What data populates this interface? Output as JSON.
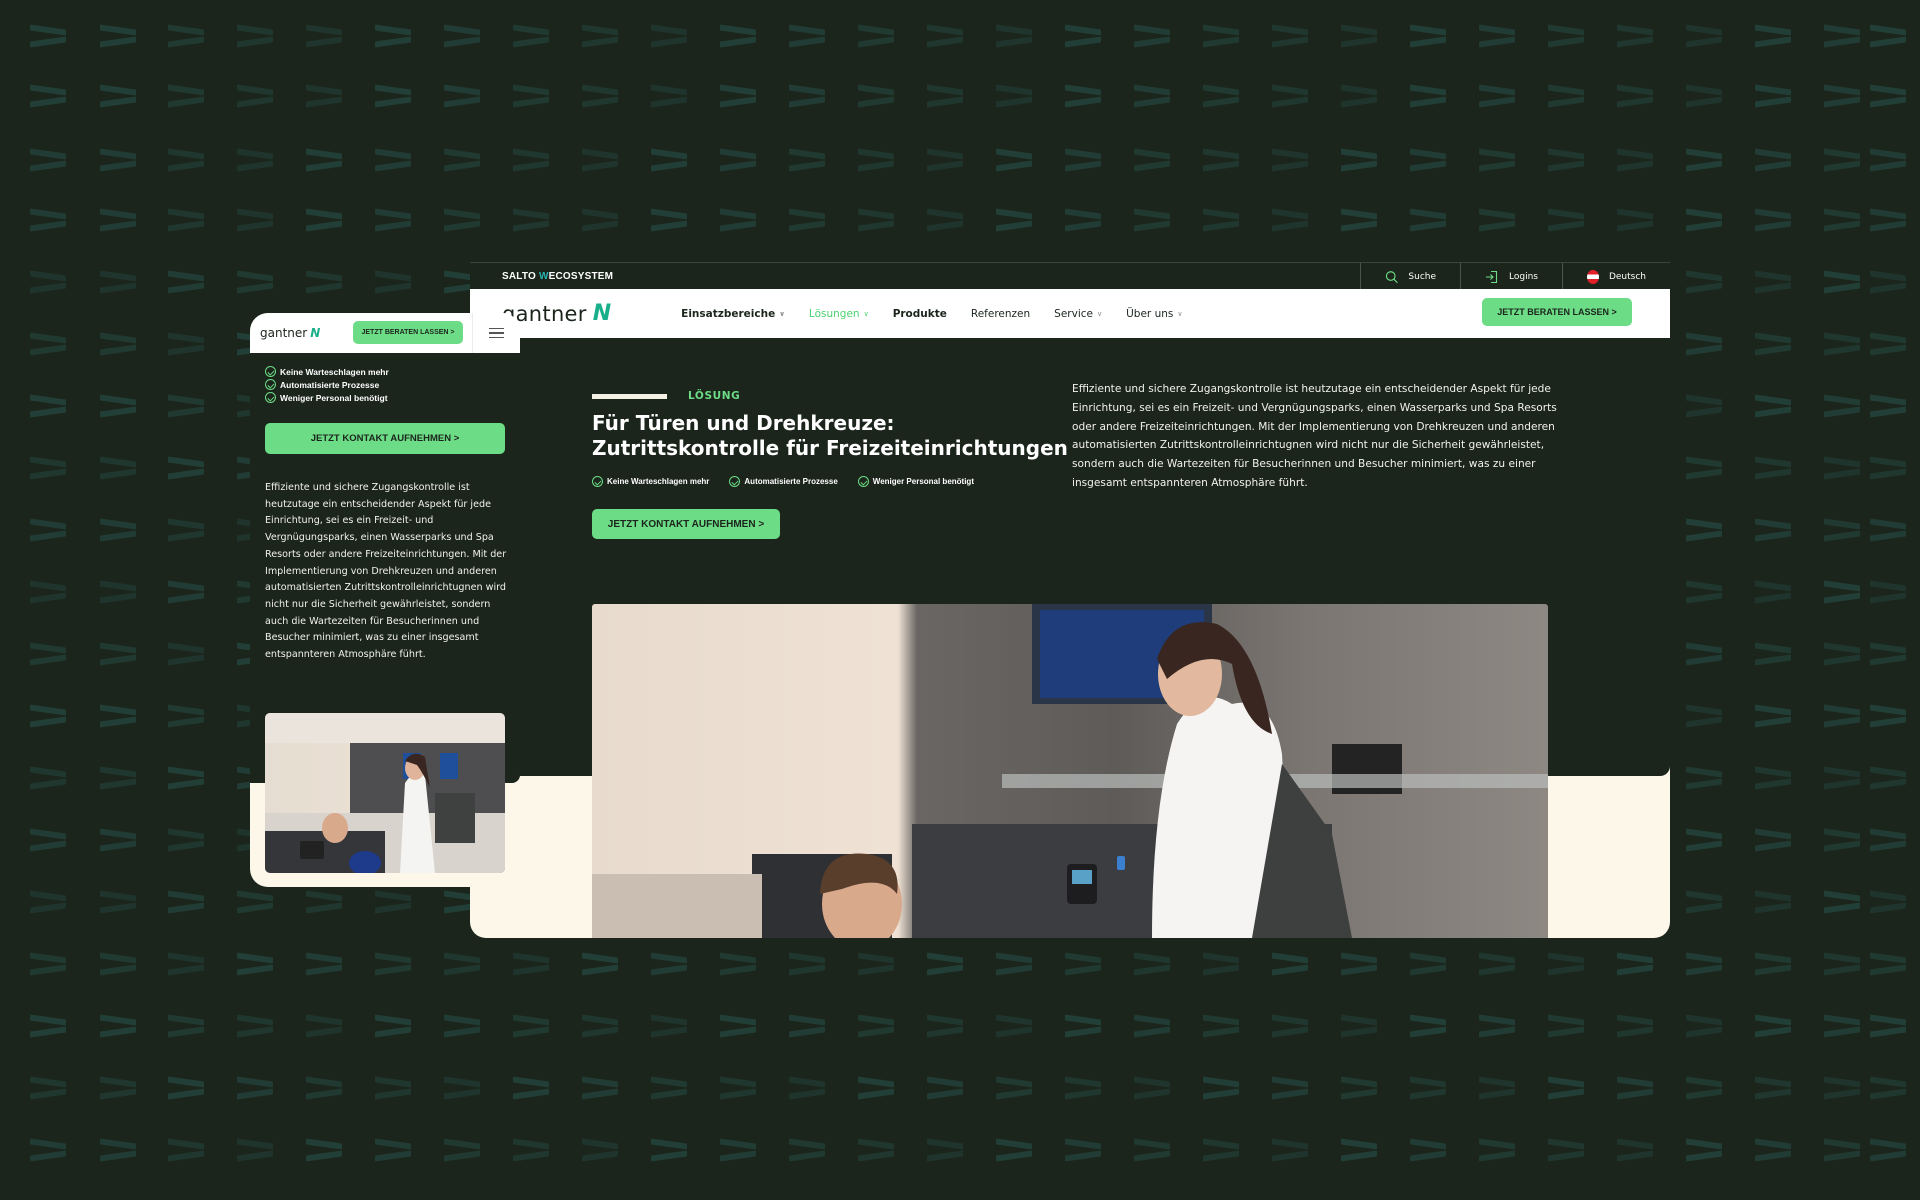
{
  "colors": {
    "page_background": "#1b251c",
    "accent_green": "#6ddc86",
    "logo_teal": "#1aaf8b",
    "cream": "#fdf7ea"
  },
  "desktop": {
    "topbar": {
      "ecosystem_prefix": "SALTO ",
      "ecosystem_w": "W",
      "ecosystem_suffix": "ECOSYSTEM",
      "search_label": "Suche",
      "logins_label": "Logins",
      "language_label": "Deutsch"
    },
    "logo": {
      "word": "gantner",
      "mark": "N"
    },
    "nav": [
      {
        "label": "Einsatzbereiche",
        "dropdown": true,
        "active": false,
        "bold": true
      },
      {
        "label": "Lösungen",
        "dropdown": true,
        "active": true,
        "bold": false
      },
      {
        "label": "Produkte",
        "dropdown": false,
        "active": false,
        "bold": true
      },
      {
        "label": "Referenzen",
        "dropdown": false,
        "active": false,
        "bold": false
      },
      {
        "label": "Service",
        "dropdown": true,
        "active": false,
        "bold": false
      },
      {
        "label": "Über uns",
        "dropdown": true,
        "active": false,
        "bold": false
      }
    ],
    "nav_cta": "JETZT BERATEN LASSEN >",
    "hero": {
      "kicker": "LÖSUNG",
      "title": "Für Türen und Drehkreuze: Zutrittskontrolle für Freizeiteinrichtungen",
      "checks": [
        "Keine Warteschlagen mehr",
        "Automatisierte Prozesse",
        "Weniger Personal benötigt"
      ],
      "cta": "JETZT KONTAKT AUFNEHMEN >",
      "paragraph": "Effiziente und sichere Zugangskontrolle ist heutzutage ein entscheidender Aspekt für jede Einrichtung, sei es ein Freizeit- und Vergnügungsparks, einen Wasserparks und Spa Resorts oder andere Freizeiteinrichtungen. Mit der Implementierung von Drehkreuzen und anderen automatisierten Zutrittskontrolleinrichtugnen wird nicht nur die Sicherheit gewährleistet, sondern auch die Wartezeiten für Besucherinnen und Besucher minimiert, was zu einer insgesamt entspannteren Atmosphäre führt."
    },
    "photo_alt": "Frau und Junge an einem Drehkreuz mit Armband-Zutrittskontrolle"
  },
  "mobile": {
    "logo": {
      "word": "gantner",
      "mark": "N"
    },
    "nav_cta": "JETZT BERATEN LASSEN >",
    "checks": [
      "Keine Warteschlagen mehr",
      "Automatisierte Prozesse",
      "Weniger Personal benötigt"
    ],
    "cta": "JETZT KONTAKT AUFNEHMEN >",
    "paragraph": "Effiziente und sichere Zugangskontrolle ist heutzutage ein entscheidender Aspekt für jede Einrichtung, sei es ein Freizeit- und Vergnügungsparks, einen Wasserparks und Spa Resorts oder andere Freizeiteinrichtungen. Mit der Implementierung von Drehkreuzen und anderen automatisierten Zutrittskontrolleinrichtugnen wird nicht nur die Sicherheit gewährleistet, sondern auch die Wartezeiten für Besucherinnen und Besucher minimiert, was zu einer insgesamt entspannteren Atmosphäre führt."
  }
}
